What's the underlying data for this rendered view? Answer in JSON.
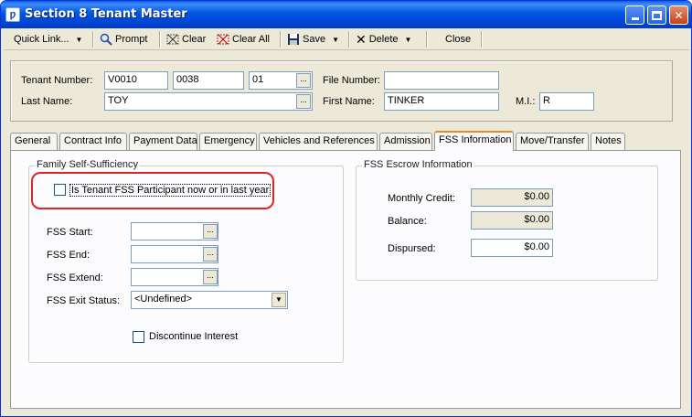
{
  "window": {
    "title": "Section 8 Tenant Master"
  },
  "toolbar": {
    "quick_link": "Quick Link...",
    "prompt": "Prompt",
    "clear": "Clear",
    "clear_all": "Clear All",
    "save": "Save",
    "delete": "Delete",
    "close": "Close"
  },
  "header": {
    "tenant_number_label": "Tenant Number:",
    "tenant_number": [
      "V0010",
      "0038",
      "01"
    ],
    "file_number_label": "File Number:",
    "file_number": "",
    "last_name_label": "Last Name:",
    "last_name": "TOY",
    "first_name_label": "First Name:",
    "first_name": "TINKER",
    "mi_label": "M.I.:",
    "mi": "R",
    "ellipsis": "..."
  },
  "tabs": [
    {
      "label": "General"
    },
    {
      "label": "Contract Info"
    },
    {
      "label": "Payment Data"
    },
    {
      "label": "Emergency"
    },
    {
      "label": "Vehicles and References"
    },
    {
      "label": "Admission"
    },
    {
      "label": "FSS Information",
      "active": true
    },
    {
      "label": "Move/Transfer"
    },
    {
      "label": "Notes"
    }
  ],
  "fss": {
    "group_label": "Family Self-Sufficiency",
    "participant_label": "Is Tenant FSS Participant now or in last year",
    "participant_checked": false,
    "start_label": "FSS Start:",
    "start_value": "",
    "end_label": "FSS End:",
    "end_value": "",
    "extend_label": "FSS Extend:",
    "extend_value": "",
    "exit_status_label": "FSS Exit Status:",
    "exit_status_value": "<Undefined>",
    "discontinue_label": "Discontinue Interest",
    "discontinue_checked": false
  },
  "escrow": {
    "group_label": "FSS Escrow Information",
    "monthly_credit_label": "Monthly Credit:",
    "monthly_credit": "$0.00",
    "balance_label": "Balance:",
    "balance": "$0.00",
    "dispursed_label": "Dispursed:",
    "dispursed": "$0.00"
  },
  "colors": {
    "titlebar": "#0055e5",
    "highlight": "#e02424",
    "active_tab_accent": "#e68b2c"
  }
}
